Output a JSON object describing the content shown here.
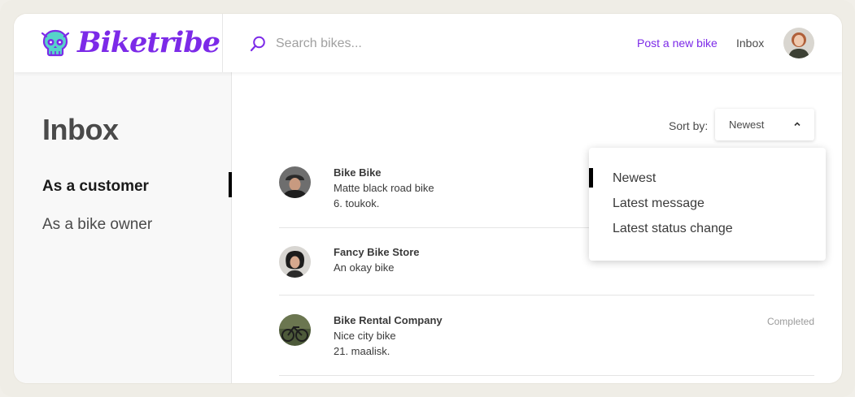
{
  "app": {
    "logo_text": "Biketribe",
    "brand_color": "#7c2ae8",
    "logo_accent": "#56d3c9"
  },
  "header": {
    "search_placeholder": "Search bikes...",
    "search_value": "",
    "post_link": "Post a new bike",
    "inbox_link": "Inbox",
    "icons": [
      "skull-logo-icon",
      "search-icon",
      "user-avatar"
    ]
  },
  "sidebar": {
    "title": "Inbox",
    "items": [
      {
        "label": "As a customer",
        "active": true
      },
      {
        "label": "As a bike owner",
        "active": false
      }
    ]
  },
  "sort": {
    "label": "Sort by:",
    "selected": "Newest",
    "options": [
      "Newest",
      "Latest message",
      "Latest status change"
    ]
  },
  "conversations": [
    {
      "name": "Bike Bike",
      "lines": [
        "Matte black road bike",
        "6. toukok."
      ],
      "status": ""
    },
    {
      "name": "Fancy Bike Store",
      "lines": [
        "An okay bike"
      ],
      "status": ""
    },
    {
      "name": "Bike Rental Company",
      "lines": [
        "Nice city bike",
        "21. maalisk."
      ],
      "status": "Completed"
    }
  ]
}
